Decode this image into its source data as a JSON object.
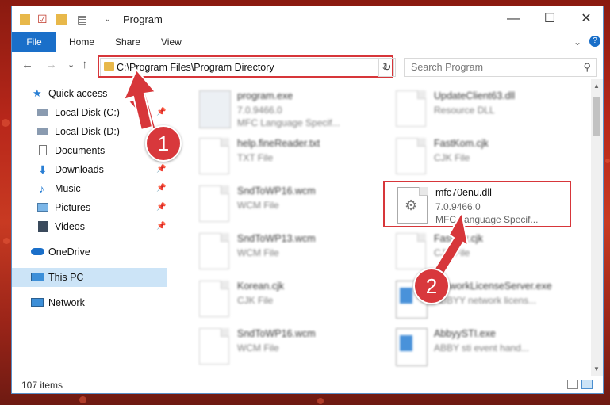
{
  "window": {
    "title": "Program",
    "minimize": "—",
    "maximize": "☐",
    "close": "✕"
  },
  "ribbon": {
    "tabs": [
      "File",
      "Home",
      "Share",
      "View"
    ],
    "expand": "⌄",
    "help": "?"
  },
  "nav": {
    "address": "C:\\Program Files\\Program Directory",
    "search_placeholder": "Search Program",
    "back": "←",
    "forward": "→",
    "recent": "⌄",
    "up": "↑",
    "refresh": "↻",
    "dropdown": "⌄",
    "search_glyph": "⚲"
  },
  "sidebar": {
    "items": [
      {
        "label": "Quick access",
        "icon": "star-icon",
        "pinned": false
      },
      {
        "label": "Local Disk (C:)",
        "icon": "drive-icon",
        "pinned": true
      },
      {
        "label": "Local Disk (D:)",
        "icon": "drive-icon",
        "pinned": false
      },
      {
        "label": "Documents",
        "icon": "document-icon",
        "pinned": false
      },
      {
        "label": "Downloads",
        "icon": "download-icon",
        "pinned": true
      },
      {
        "label": "Music",
        "icon": "music-icon",
        "pinned": true
      },
      {
        "label": "Pictures",
        "icon": "pictures-icon",
        "pinned": true
      },
      {
        "label": "Videos",
        "icon": "video-icon",
        "pinned": true
      },
      {
        "label": "OneDrive",
        "icon": "cloud-icon",
        "pinned": false
      },
      {
        "label": "This PC",
        "icon": "computer-icon",
        "pinned": false,
        "selected": true
      },
      {
        "label": "Network",
        "icon": "network-icon",
        "pinned": false
      }
    ]
  },
  "files": [
    {
      "name": "program.exe",
      "line1": "7.0.9466.0",
      "line2": "MFC Language Specif...",
      "icon": "exe-icon"
    },
    {
      "name": "UpdateClient63.dll",
      "line1": "Resource DLL",
      "line2": "",
      "icon": "dll-icon"
    },
    {
      "name": "help.fineReader.txt",
      "line1": "TXT File",
      "line2": "",
      "icon": "text-file-icon"
    },
    {
      "name": "FastKom.cjk",
      "line1": "CJK File",
      "line2": "",
      "icon": "file-icon"
    },
    {
      "name": "SndToWP16.wcm",
      "line1": "WCM File",
      "line2": "",
      "icon": "file-icon"
    },
    {
      "name": "mfc70enu.dll",
      "line1": "7.0.9466.0",
      "line2": "MFC Language Specif...",
      "icon": "dll-gear-icon"
    },
    {
      "name": "SndToWP13.wcm",
      "line1": "WCM File",
      "line2": "",
      "icon": "file-icon"
    },
    {
      "name": "FastKor.cjk",
      "line1": "CJK File",
      "line2": "",
      "icon": "file-icon"
    },
    {
      "name": "Korean.cjk",
      "line1": "CJK File",
      "line2": "",
      "icon": "file-icon"
    },
    {
      "name": "NetworkLicenseServer.exe",
      "line1": "ABBYY network licens...",
      "line2": "",
      "icon": "app-window-icon"
    },
    {
      "name": "SndToWP16.wcm",
      "line1": "WCM File",
      "line2": "",
      "icon": "file-icon"
    },
    {
      "name": "AbbyySTI.exe",
      "line1": "ABBY sti event hand...",
      "line2": "",
      "icon": "app-window-icon"
    }
  ],
  "status": {
    "count": "107 items"
  },
  "annotations": {
    "step1": "1",
    "step2": "2"
  },
  "colors": {
    "accent": "#1a6fc9",
    "highlight": "#d7363a",
    "selected": "#cce4f7",
    "folder": "#e8b84a"
  }
}
